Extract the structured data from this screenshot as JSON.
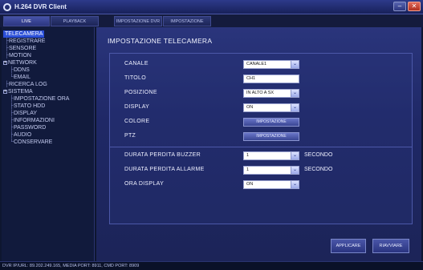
{
  "app": {
    "title": "H.264 DVR Client",
    "minimize_glyph": "–",
    "close_glyph": "✕"
  },
  "tabs": [
    "LIVE",
    "PLAYBACK",
    "IMPOSTAZIONE DVR",
    "IMPOSTAZIONE RAGNE"
  ],
  "sidebar": {
    "items": [
      {
        "label": "TELECAMERA",
        "selected": true
      },
      {
        "label": "REGISTRARE"
      },
      {
        "label": "SENSORE"
      },
      {
        "label": "MOTION"
      },
      {
        "label": "NETWORK",
        "expander": "+"
      },
      {
        "label": "DDNS"
      },
      {
        "label": "EMAIL"
      },
      {
        "label": "RICERCA LOG"
      },
      {
        "label": "SISTEMA",
        "expander": "+"
      },
      {
        "label": "IMPOSTAZIONE ORA"
      },
      {
        "label": "STATO HDD"
      },
      {
        "label": "DISPLAY"
      },
      {
        "label": "INFORMAZIONI"
      },
      {
        "label": "PASSWORD"
      },
      {
        "label": "AUDIO"
      },
      {
        "label": "CONSERVARE"
      }
    ]
  },
  "main": {
    "title": "IMPOSTAZIONE TELECAMERA",
    "fields": {
      "canale": {
        "label": "CANALE",
        "value": "CANALE1"
      },
      "titolo": {
        "label": "TITOLO",
        "value": "CH1"
      },
      "posizione": {
        "label": "POSIZIONE",
        "value": "IN ALTO A SX"
      },
      "display": {
        "label": "DISPLAY",
        "value": "ON"
      },
      "colore": {
        "label": "COLORE",
        "button": "IMPOSTAZIONE"
      },
      "ptz": {
        "label": "PTZ",
        "button": "IMPOSTAZIONE"
      },
      "buzzer": {
        "label": "DURATA PERDITA BUZZER",
        "value": "1",
        "unit": "SECONDO"
      },
      "allarme": {
        "label": "DURATA PERDITA ALLARME",
        "value": "1",
        "unit": "SECONDO"
      },
      "ora_display": {
        "label": "ORA DISPLAY",
        "value": "ON"
      }
    },
    "dropdown_arrow": "⌄",
    "buttons": {
      "apply": "APPLICARE",
      "restore": "RIAVVIARE"
    }
  },
  "status": {
    "text": "DVR IP/URL: 89.202.249.165, MEDIA PORT: 8911, CMD PORT: 8909"
  }
}
